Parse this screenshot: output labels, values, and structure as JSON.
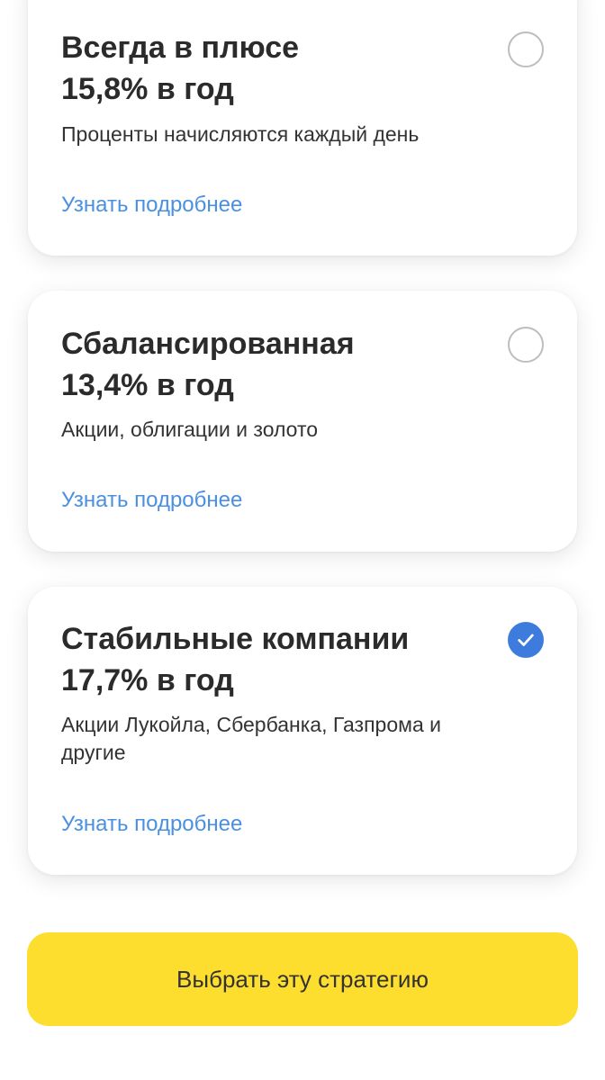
{
  "strategies": [
    {
      "title": "Всегда в плюсе",
      "rate": "15,8% в год",
      "description": "Проценты начисляются каждый день",
      "more_label": "Узнать подробнее",
      "selected": false
    },
    {
      "title": "Сбалансированная",
      "rate": "13,4% в год",
      "description": "Акции, облигации и золото",
      "more_label": "Узнать подробнее",
      "selected": false
    },
    {
      "title": "Стабильные компании",
      "rate": "17,7% в год",
      "description": "Акции Лукойла, Сбербанка, Газпрома и другие",
      "more_label": "Узнать подробнее",
      "selected": true
    }
  ],
  "cta": {
    "label": "Выбрать эту стратегию"
  },
  "colors": {
    "accent_blue": "#3d7bdc",
    "link_blue": "#4a90e2",
    "cta_yellow": "#fddd2d",
    "text_dark": "#2b2b2b"
  }
}
